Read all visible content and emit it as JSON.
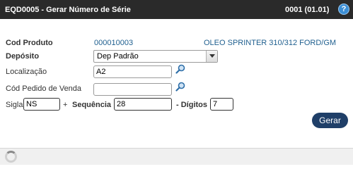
{
  "header": {
    "title": "EQD0005 - Gerar Número de Série",
    "code": "0001 (01.01)",
    "help_icon": "?"
  },
  "form": {
    "cod_produto_label": "Cod Produto",
    "cod_produto_value": "000010003",
    "produto_descricao": "OLEO SPRINTER 310/312 FORD/GM",
    "deposito_label": "Depósito",
    "deposito_value": "Dep Padrão",
    "localizacao_label": "Localização",
    "localizacao_value": "A2",
    "pedido_label": "Cód Pedido de Venda",
    "pedido_value": "",
    "sigla_label": "Sigla",
    "sigla_value": "NS",
    "plus": "+",
    "sequencia_label": "Sequência",
    "sequencia_value": "28",
    "digitos_label": "- Dígitos",
    "digitos_value": "7"
  },
  "actions": {
    "gerar_label": "Gerar"
  },
  "colors": {
    "titlebar": "#2a2a2a",
    "button": "#1f3f68",
    "link_blue": "#1f5f8f"
  },
  "icons": {
    "search": "magnifier-icon",
    "help": "help-icon",
    "loading": "spinner-icon"
  }
}
